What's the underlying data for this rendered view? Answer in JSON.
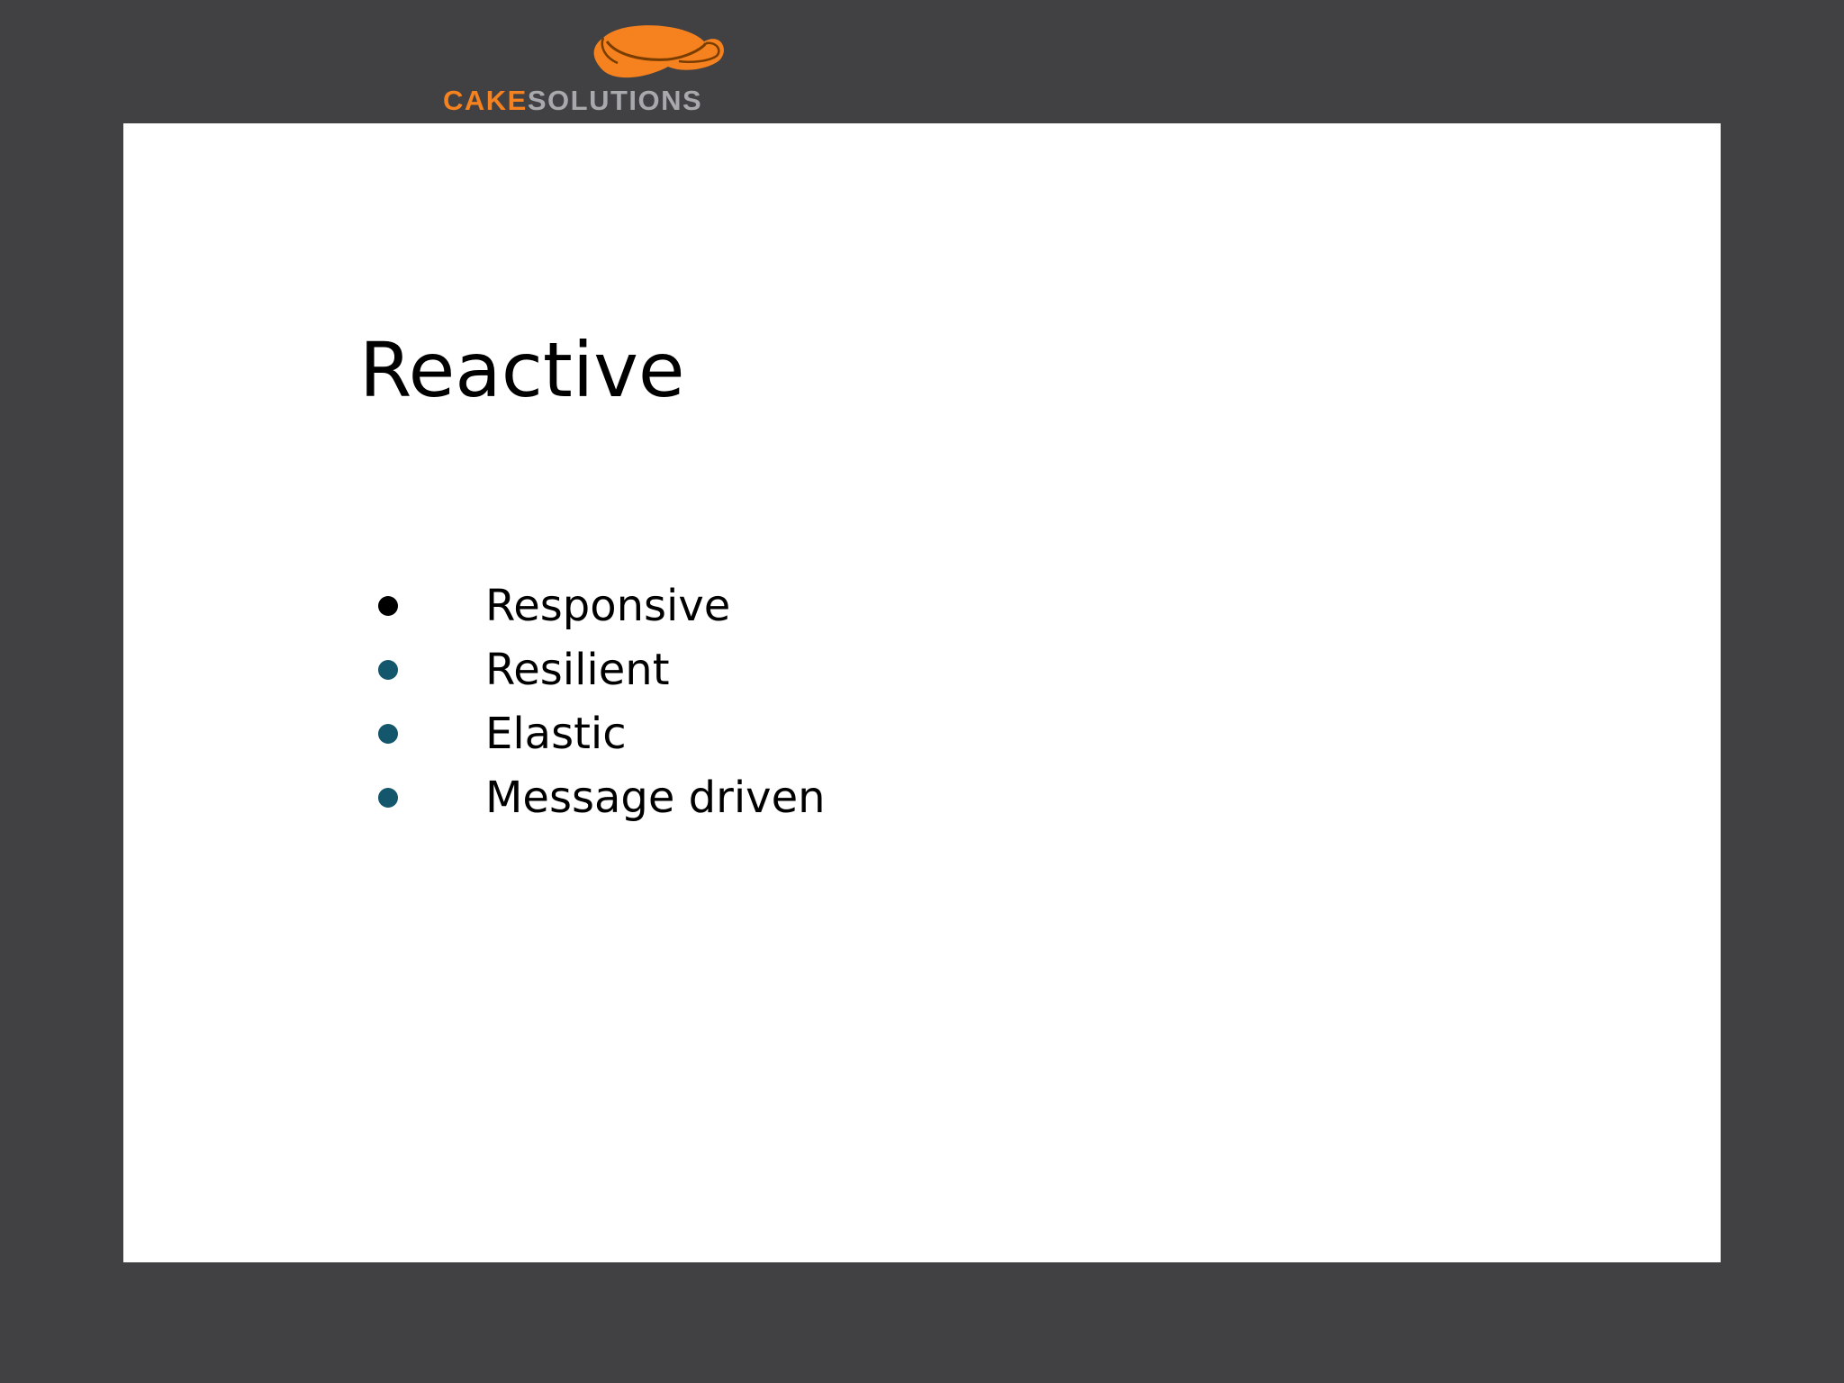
{
  "colors": {
    "background": "#414042",
    "slide": "#ffffff",
    "brand_orange": "#f5821f",
    "brand_grey": "#a7a9ac",
    "first_bullet": "#000000",
    "other_bullets": "#14566b"
  },
  "logo": {
    "icon": "cake-solutions-ribbon-icon",
    "word_cake": "CAKE",
    "word_solutions": "SOLUTIONS"
  },
  "slide": {
    "title": "Reactive",
    "bullets": [
      {
        "label": "Responsive"
      },
      {
        "label": "Resilient"
      },
      {
        "label": "Elastic"
      },
      {
        "label": "Message driven"
      }
    ]
  }
}
